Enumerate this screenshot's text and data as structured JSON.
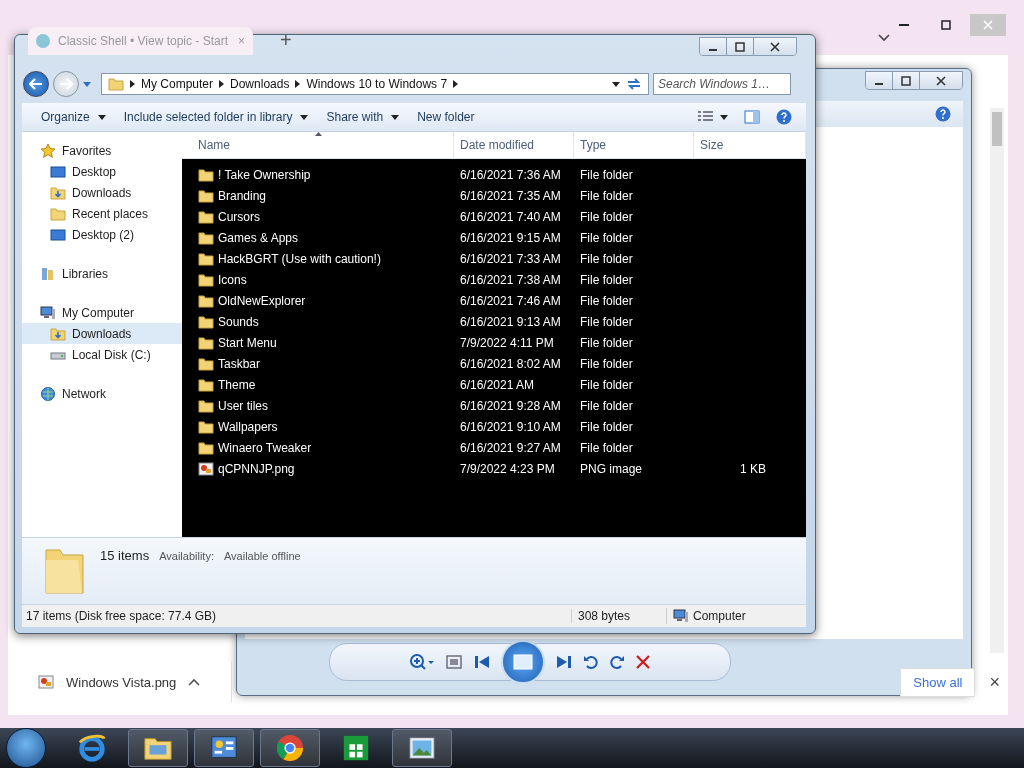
{
  "browser": {
    "tab_title": "Classic Shell • View topic - Start",
    "tab_close": "×",
    "new_tab": "+"
  },
  "explorer": {
    "breadcrumb": [
      "My Computer",
      "Downloads",
      "Windows 10 to Windows 7"
    ],
    "search": {
      "placeholder": "Search Windows 1…"
    },
    "toolbar": [
      {
        "label": "Organize",
        "dropdown": true
      },
      {
        "label": "Include selected folder in library",
        "dropdown": true
      },
      {
        "label": "Share with",
        "dropdown": true
      },
      {
        "label": "New folder",
        "dropdown": false
      }
    ],
    "nav": [
      {
        "label": "Favorites",
        "kind": "star",
        "selected": false,
        "children": [
          {
            "label": "Desktop",
            "kind": "desktop",
            "selected": false
          },
          {
            "label": "Downloads",
            "kind": "downloads",
            "selected": false
          },
          {
            "label": "Recent places",
            "kind": "recent",
            "selected": false
          },
          {
            "label": "Desktop (2)",
            "kind": "desktop",
            "selected": false
          }
        ]
      },
      {
        "label": "Libraries",
        "kind": "library",
        "selected": false
      },
      {
        "label": "My Computer",
        "kind": "computer",
        "selected": false,
        "children": [
          {
            "label": "Downloads",
            "kind": "downloads",
            "selected": true
          },
          {
            "label": "Local Disk (C:)",
            "kind": "drive",
            "selected": false
          }
        ]
      },
      {
        "label": "Network",
        "kind": "network",
        "selected": false
      }
    ],
    "columns": [
      {
        "label": "Name",
        "sorted": true
      },
      {
        "label": "Date modified",
        "sorted": false
      },
      {
        "label": "Type",
        "sorted": false
      },
      {
        "label": "Size",
        "sorted": false
      }
    ],
    "rows": [
      {
        "kind": "folder",
        "name": "! Take Ownership",
        "date": "6/16/2021 7:36 AM",
        "type": "File folder"
      },
      {
        "kind": "folder",
        "name": "Branding",
        "date": "6/16/2021 7:35 AM",
        "type": "File folder"
      },
      {
        "kind": "folder",
        "name": "Cursors",
        "date": "6/16/2021 7:40 AM",
        "type": "File folder"
      },
      {
        "kind": "folder",
        "name": "Games & Apps",
        "date": "6/16/2021 9:15 AM",
        "type": "File folder"
      },
      {
        "kind": "folder",
        "name": "HackBGRT (Use with caution!)",
        "date": "6/16/2021 7:33 AM",
        "type": "File folder"
      },
      {
        "kind": "folder",
        "name": "Icons",
        "date": "6/16/2021 7:38 AM",
        "type": "File folder"
      },
      {
        "kind": "folder",
        "name": "OldNewExplorer",
        "date": "6/16/2021 7:46 AM",
        "type": "File folder"
      },
      {
        "kind": "folder",
        "name": "Sounds",
        "date": "6/16/2021 9:13 AM",
        "type": "File folder"
      },
      {
        "kind": "folder",
        "name": "Start Menu",
        "date": "7/9/2022 4:11 PM",
        "type": "File folder"
      },
      {
        "kind": "folder",
        "name": "Taskbar",
        "date": "6/16/2021 8:02 AM",
        "type": "File folder"
      },
      {
        "kind": "folder",
        "name": "Theme",
        "date": "6/16/2021 AM",
        "type": "File folder"
      },
      {
        "kind": "folder",
        "name": "User tiles",
        "date": "6/16/2021 9:28 AM",
        "type": "File folder"
      },
      {
        "kind": "folder",
        "name": "Wallpapers",
        "date": "6/16/2021 9:10 AM",
        "type": "File folder"
      },
      {
        "kind": "folder",
        "name": "Winaero Tweaker",
        "date": "6/16/2021 9:27 AM",
        "type": "File folder"
      },
      {
        "kind": "image",
        "name": "qCPNNJP.png",
        "date": "7/9/2022 4:23 PM",
        "type": "PNG image",
        "size": "1 KB"
      }
    ],
    "details": {
      "count": "15 items",
      "availability_label": "Availability:",
      "availability": "Available offline"
    },
    "status": {
      "items": "17 items (Disk free space: 77.4 GB)",
      "size": "308 bytes",
      "zone": "Computer"
    }
  },
  "download_bar": {
    "file_name": "Windows Vista.png",
    "show_all": "Show all",
    "close": "×"
  },
  "taskbar": {
    "apps": [
      {
        "kind": "ie",
        "running": false
      },
      {
        "kind": "explorer",
        "running": true
      },
      {
        "kind": "control",
        "running": true
      },
      {
        "kind": "chrome",
        "running": true
      },
      {
        "kind": "store",
        "running": false
      },
      {
        "kind": "photos",
        "running": true
      }
    ]
  }
}
